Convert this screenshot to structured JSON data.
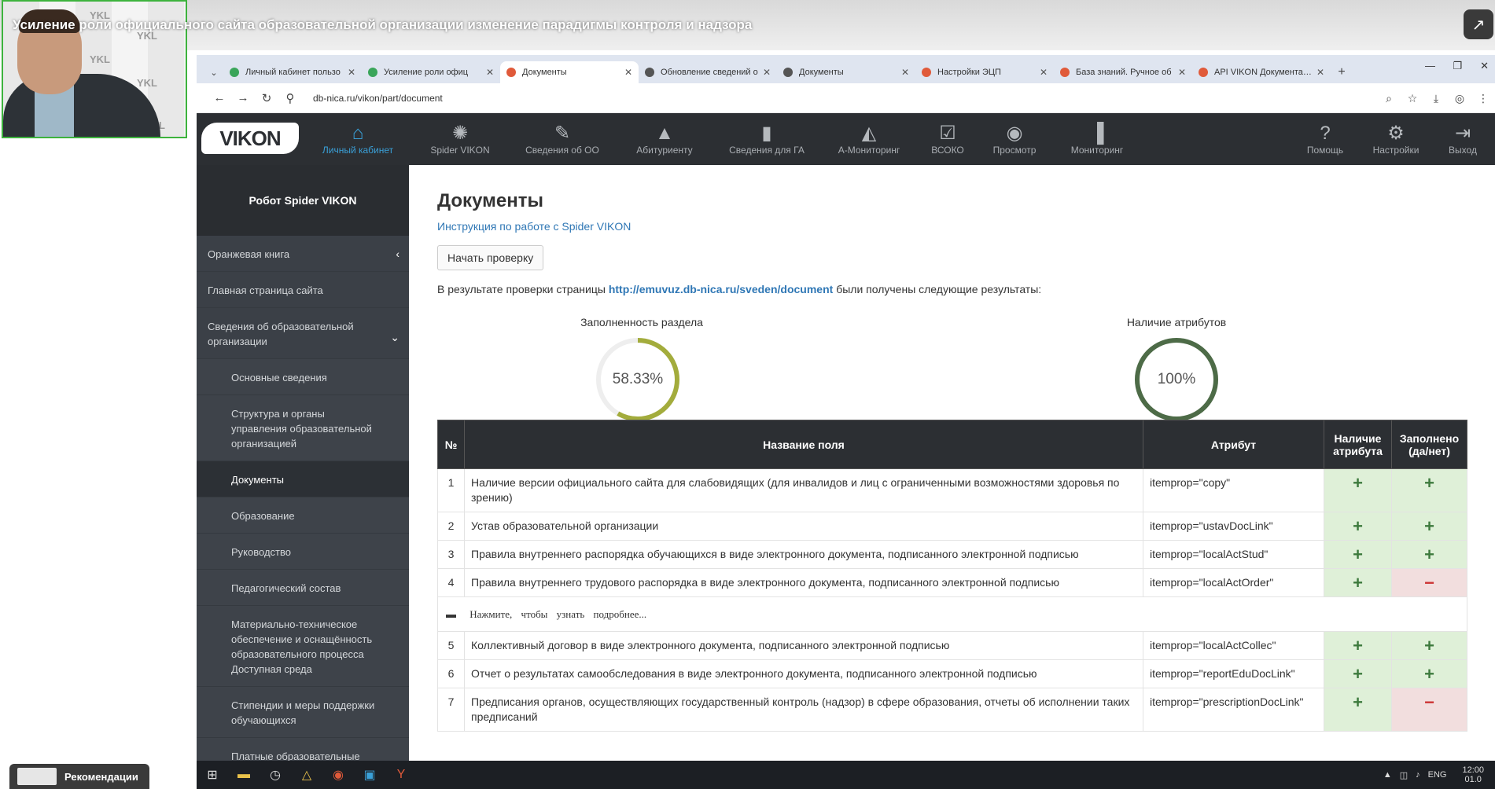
{
  "video": {
    "title": "Усиление роли официального сайта образовательной организации изменение парадигмы контроля и надзора",
    "recommendations_label": "Рекомендации"
  },
  "webcam": {
    "wall_text": "YKL"
  },
  "browser": {
    "tabs": [
      {
        "label": "Личный кабинет пользо",
        "color": "#3aa55a"
      },
      {
        "label": "Усиление роли офиц",
        "color": "#3aa55a"
      },
      {
        "label": "Документы",
        "color": "#e05a3a"
      },
      {
        "label": "Обновление сведений о",
        "color": "#555555"
      },
      {
        "label": "Документы",
        "color": "#555555"
      },
      {
        "label": "Настройки ЭЦП",
        "color": "#e05a3a"
      },
      {
        "label": "База знаний. Ручное об",
        "color": "#e05a3a"
      },
      {
        "label": "API VIKON Документаци",
        "color": "#e05a3a"
      }
    ],
    "url": "db-nica.ru/vikon/part/document"
  },
  "nav": {
    "logo": "VIKON",
    "items": [
      {
        "label": "Личный кабинет",
        "icon": "⌂"
      },
      {
        "label": "Spider VIKON",
        "icon": "✺"
      },
      {
        "label": "Сведения об ОО",
        "icon": "✎"
      },
      {
        "label": "Абитуриенту",
        "icon": "🎓"
      },
      {
        "label": "Сведения для ГА",
        "icon": "▮"
      },
      {
        "label": "А-Мониторинг",
        "icon": "◭"
      },
      {
        "label": "ВСОКО",
        "icon": "☑"
      },
      {
        "label": "Просмотр",
        "icon": "◉"
      },
      {
        "label": "Мониторинг",
        "icon": "▐"
      }
    ],
    "right_items": [
      {
        "label": "Помощь",
        "icon": "?"
      },
      {
        "label": "Настройки",
        "icon": "⚙"
      },
      {
        "label": "Выход",
        "icon": "⇥"
      }
    ]
  },
  "sidebar": {
    "header": "Робот Spider VIKON",
    "items": [
      {
        "label": "Оранжевая книга"
      },
      {
        "label": "Главная страница сайта"
      },
      {
        "label": "Сведения об образовательной организации"
      },
      {
        "label": "Основные сведения"
      },
      {
        "label": "Структура и органы управления образовательной организацией"
      },
      {
        "label": "Документы"
      },
      {
        "label": "Образование"
      },
      {
        "label": "Руководство"
      },
      {
        "label": "Педагогический состав"
      },
      {
        "label": "Материально-техническое обеспечение и оснащённость образовательного процесса Доступная среда"
      },
      {
        "label": "Стипендии и меры поддержки обучающихся"
      },
      {
        "label": "Платные образовательные услуги"
      }
    ]
  },
  "main": {
    "title": "Документы",
    "instruction_link": "Инструкция по работе с Spider VIKON",
    "start_button": "Начать проверку",
    "result_prefix": "В результате проверки страницы",
    "result_url": "http://emuvuz.db-nica.ru/sveden/document",
    "result_suffix": "были получены следующие результаты:",
    "gauge_fill": {
      "label": "Заполненность раздела",
      "value": "58.33%",
      "fraction": 0.5833,
      "color": "#a3ac3c"
    },
    "gauge_attr": {
      "label": "Наличие атрибутов",
      "value": "100%",
      "fraction": 1.0,
      "color": "#4d6b47"
    }
  },
  "table": {
    "headers": {
      "num": "№",
      "name": "Название поля",
      "attr": "Атрибут",
      "has_attr": "Наличие атрибута",
      "filled": "Заполнено (да/нет)"
    },
    "detail_text": "Нажмите, чтобы узнать подробнее...",
    "rows": [
      {
        "num": "1",
        "name": "Наличие версии официального сайта для слабовидящих (для инвалидов и лиц с ограниченными возможностями здоровья по зрению)",
        "attr": "itemprop=\"copy\"",
        "has": "+",
        "filled": "+"
      },
      {
        "num": "2",
        "name": "Устав образовательной организации",
        "attr": "itemprop=\"ustavDocLink\"",
        "has": "+",
        "filled": "+"
      },
      {
        "num": "3",
        "name": "Правила внутреннего распорядка обучающихся в виде электронного документа, подписанного электронной подписью",
        "attr": "itemprop=\"localActStud\"",
        "has": "+",
        "filled": "+"
      },
      {
        "num": "4",
        "name": "Правила внутреннего трудового распорядка в виде электронного документа, подписанного электронной подписью",
        "attr": "itemprop=\"localActOrder\"",
        "has": "+",
        "filled": "−"
      },
      {
        "num": "5",
        "name": "Коллективный договор в виде электронного документа, подписанного электронной подписью",
        "attr": "itemprop=\"localActCollec\"",
        "has": "+",
        "filled": "+"
      },
      {
        "num": "6",
        "name": "Отчет о результатах самообследования в виде электронного документа, подписанного электронной подписью",
        "attr": "itemprop=\"reportEduDocLink\"",
        "has": "+",
        "filled": "+"
      },
      {
        "num": "7",
        "name": "Предписания органов, осуществляющих государственный контроль (надзор) в сфере образования, отчеты об исполнении таких предписаний",
        "attr": "itemprop=\"prescriptionDocLink\"",
        "has": "+",
        "filled": "−"
      }
    ]
  },
  "taskbar": {
    "lang": "ENG",
    "time": "12:00",
    "date": "01.0"
  }
}
